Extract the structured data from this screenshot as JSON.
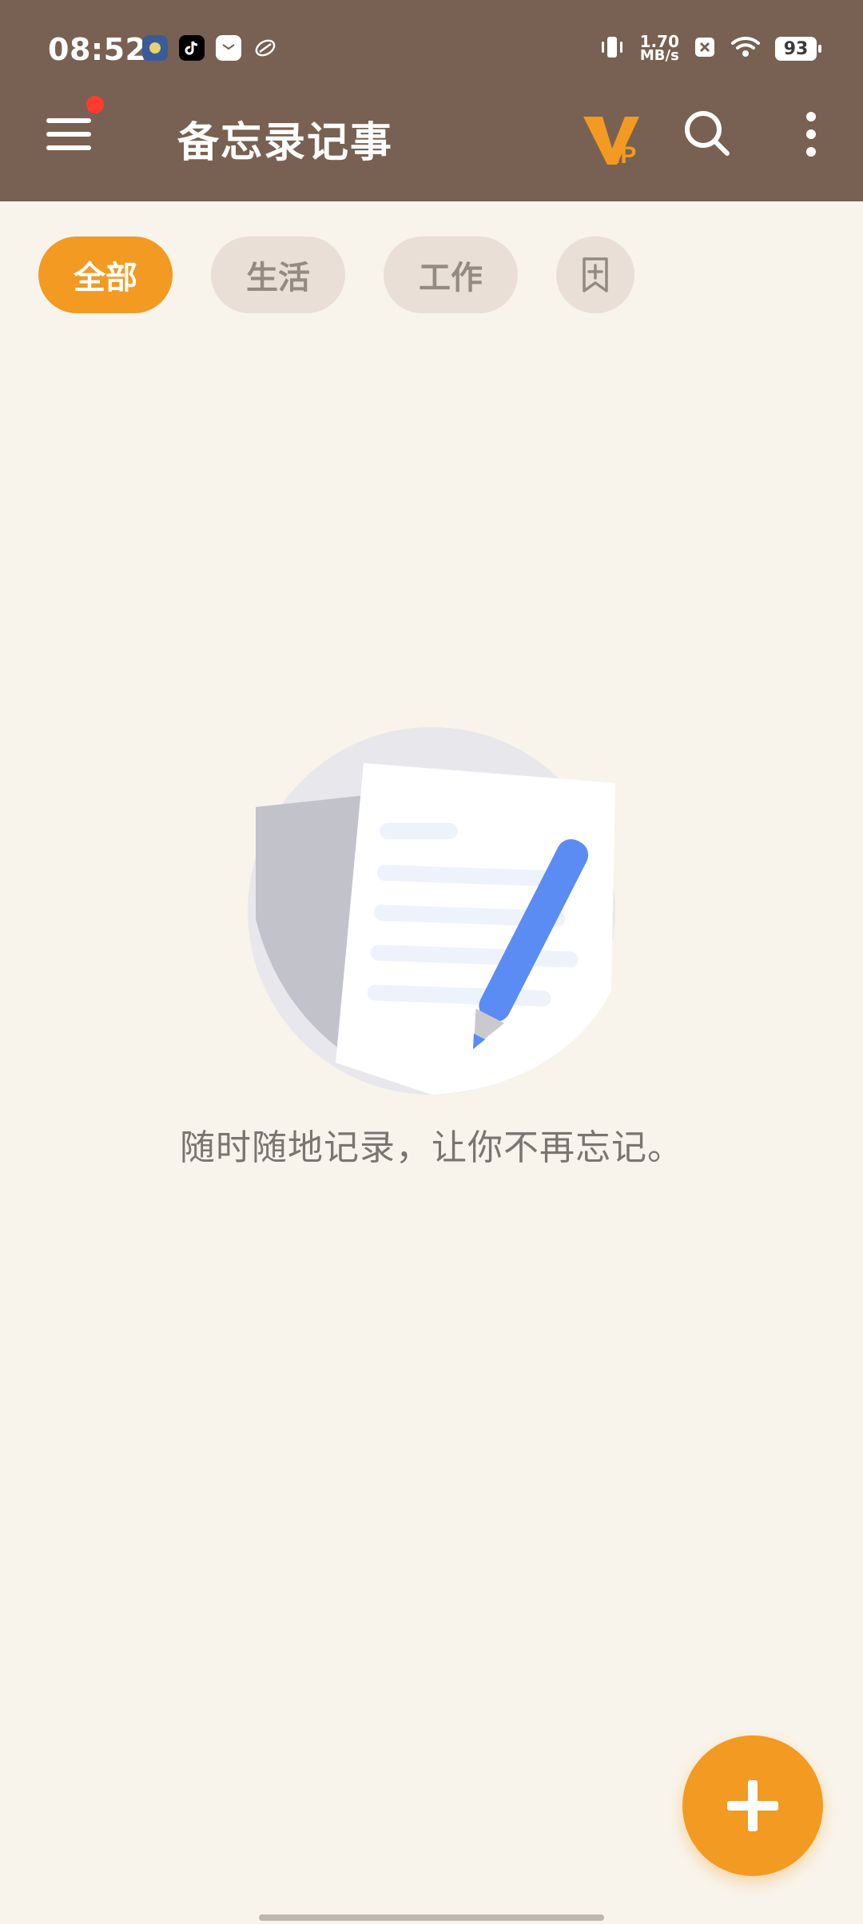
{
  "status_bar": {
    "time": "08:52",
    "net_speed_value": "1.70",
    "net_speed_unit": "MB/s",
    "battery": "93",
    "left_icons": [
      "notification-icon-1",
      "tiktok-icon",
      "mail-icon",
      "tag-icon"
    ],
    "right_icons": [
      "vibrate-icon",
      "close-box-icon",
      "wifi-icon",
      "battery-icon"
    ]
  },
  "app_bar": {
    "title": "备忘录记事",
    "menu_icon": "hamburger-menu-icon",
    "vip_icon": "vip-icon",
    "search_icon": "search-icon",
    "more_icon": "more-vertical-icon",
    "badge_color": "#FF3B30"
  },
  "chips": [
    {
      "label": "全部",
      "active": true
    },
    {
      "label": "生活",
      "active": false
    },
    {
      "label": "工作",
      "active": false
    },
    {
      "label": "",
      "active": false,
      "icon": "add-bookmark-icon"
    }
  ],
  "empty_state": {
    "message": "随时随地记录，让你不再忘记。",
    "illustration_icon": "notes-pencil-illustration"
  },
  "fab": {
    "icon": "plus-icon"
  },
  "colors": {
    "header": "#786152",
    "background": "#F8F4EB",
    "accent": "#F29A22",
    "chip_bg": "#E9DFD6",
    "chip_text": "#938A80",
    "text_muted": "#7A7570",
    "pencil_blue": "#5B8CF4",
    "vip": "#F29A22"
  }
}
